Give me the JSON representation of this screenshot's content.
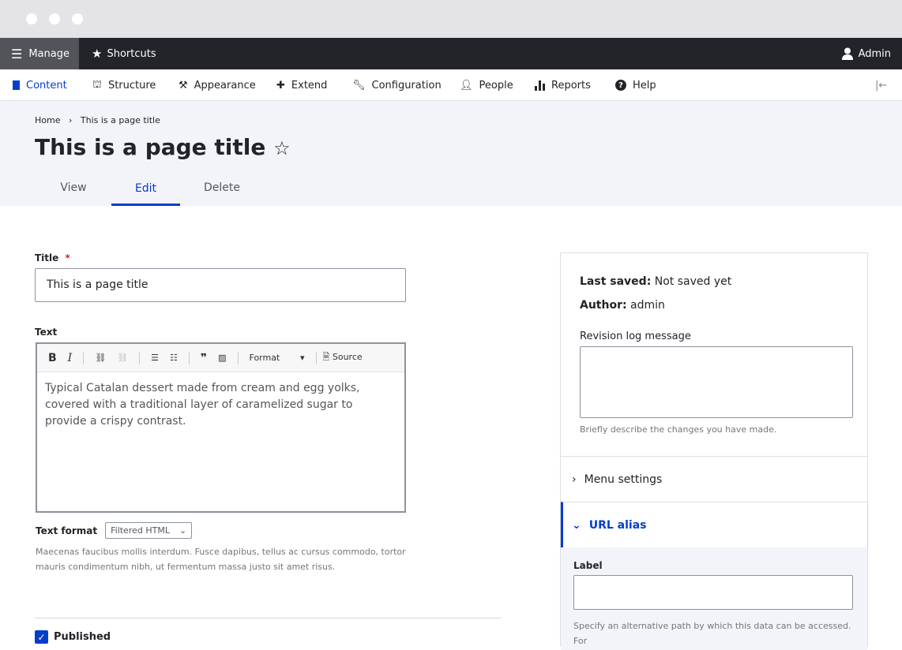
{
  "toolbar": {
    "manage": "Manage",
    "shortcuts": "Shortcuts",
    "user": "Admin"
  },
  "nav": {
    "items": [
      {
        "label": "Content",
        "icon": "document-icon"
      },
      {
        "label": "Structure",
        "icon": "sitemap-icon"
      },
      {
        "label": "Appearance",
        "icon": "paintbrush-icon"
      },
      {
        "label": "Extend",
        "icon": "puzzle-icon"
      },
      {
        "label": "Configuration",
        "icon": "wrench-icon"
      },
      {
        "label": "People",
        "icon": "people-icon"
      },
      {
        "label": "Reports",
        "icon": "bar-chart-icon"
      },
      {
        "label": "Help",
        "icon": "help-icon"
      }
    ],
    "collapse_icon": "collapse-left-icon"
  },
  "breadcrumb": {
    "home": "Home",
    "sep": "›",
    "current": "This is a page title"
  },
  "page": {
    "title": "This is a page title",
    "tabs": [
      "View",
      "Edit",
      "Delete"
    ]
  },
  "form": {
    "title_label": "Title",
    "required": "*",
    "title_value": "This is a page title",
    "text_label": "Text",
    "editor": {
      "format": "Format",
      "source": "Source",
      "bold": "B",
      "italic": "I",
      "quote": "99",
      "body": "Typical Catalan dessert made from cream and egg yolks, covered with a traditional layer of caramelized sugar to provide a crispy contrast."
    },
    "text_format_label": "Text format",
    "text_format_value": "Filtered HTML",
    "text_format_help": "Maecenas faucibus mollis interdum. Fusce dapibus, tellus ac cursus commodo, tortor mauris condimentum nibh, ut fermentum massa justo sit amet risus.",
    "published": "Published",
    "published_checked": true
  },
  "sidebar": {
    "last_saved_label": "Last saved:",
    "last_saved_value": "Not saved yet",
    "author_label": "Author:",
    "author_value": "admin",
    "revision_label": "Revision log message",
    "revision_help": "Briefly describe the changes you have made.",
    "menu_settings": "Menu settings",
    "url_alias": "URL alias",
    "alias_label": "Label",
    "alias_help": "Specify an alternative path by which this data can be accessed. For"
  },
  "colors": {
    "accent": "#003ecc",
    "toolbar": "#232429",
    "header_bg": "#f3f4f9"
  }
}
